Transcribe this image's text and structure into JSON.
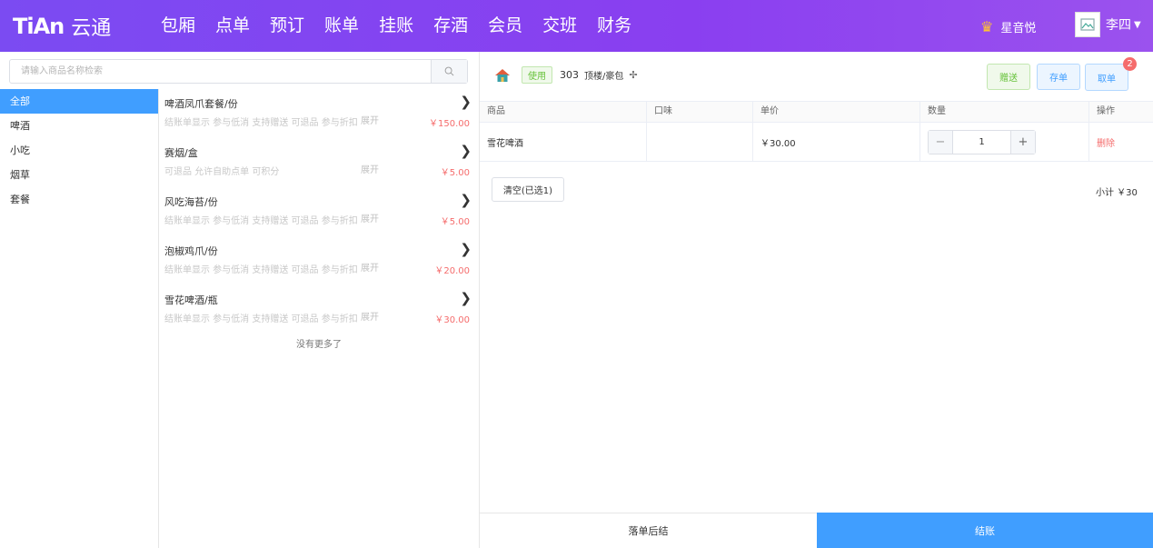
{
  "header": {
    "logo_mark": "TiAn",
    "logo_text": "云通",
    "nav": [
      "包厢",
      "点单",
      "预订",
      "账单",
      "挂账",
      "存酒",
      "会员",
      "交班",
      "财务"
    ],
    "store": "星音悦",
    "user": "李四"
  },
  "search": {
    "placeholder": "请输入商品名称检索"
  },
  "categories": [
    {
      "label": "全部",
      "active": true
    },
    {
      "label": "啤酒",
      "active": false
    },
    {
      "label": "小吃",
      "active": false
    },
    {
      "label": "烟草",
      "active": false
    },
    {
      "label": "套餐",
      "active": false
    }
  ],
  "products": [
    {
      "name": "啤酒凤爪套餐/份",
      "tags": "结账单显示 参与低消 支持赠送 可退品 参与折扣",
      "expand": "展开",
      "price": "￥150.00"
    },
    {
      "name": "赛烟/盒",
      "tags": "可退品 允许自助点单 可积分",
      "expand": "展开",
      "price": "￥5.00"
    },
    {
      "name": "风吃海苔/份",
      "tags": "结账单显示 参与低消 支持赠送 可退品 参与折扣",
      "expand": "展开",
      "price": "￥5.00"
    },
    {
      "name": "泡椒鸡爪/份",
      "tags": "结账单显示 参与低消 支持赠送 可退品 参与折扣",
      "expand": "展开",
      "price": "￥20.00"
    },
    {
      "name": "雪花啤酒/瓶",
      "tags": "结账单显示 参与低消 支持赠送 可退品 参与折扣",
      "expand": "展开",
      "price": "￥30.00"
    }
  ],
  "no_more": "没有更多了",
  "room": {
    "status": "使用",
    "number": "303",
    "name": "顶楼/豪包"
  },
  "actions": {
    "gift": "赠送",
    "store": "存单",
    "take": "取单",
    "badge": "2"
  },
  "table": {
    "headers": [
      "商品",
      "口味",
      "单价",
      "数量",
      "操作"
    ],
    "rows": [
      {
        "name": "雪花啤酒",
        "flavor": "",
        "price": "￥30.00",
        "qty": "1",
        "op": "删除"
      }
    ]
  },
  "clear_label": "清空(已选1)",
  "subtotal": "小计 ￥30",
  "footer": {
    "later": "落单后结",
    "checkout": "结账"
  },
  "colors": {
    "header_from": "#7b4bf2",
    "header_to": "#9b52ee",
    "primary": "#409eff",
    "danger": "#f56c6c",
    "success": "#67c23a"
  }
}
